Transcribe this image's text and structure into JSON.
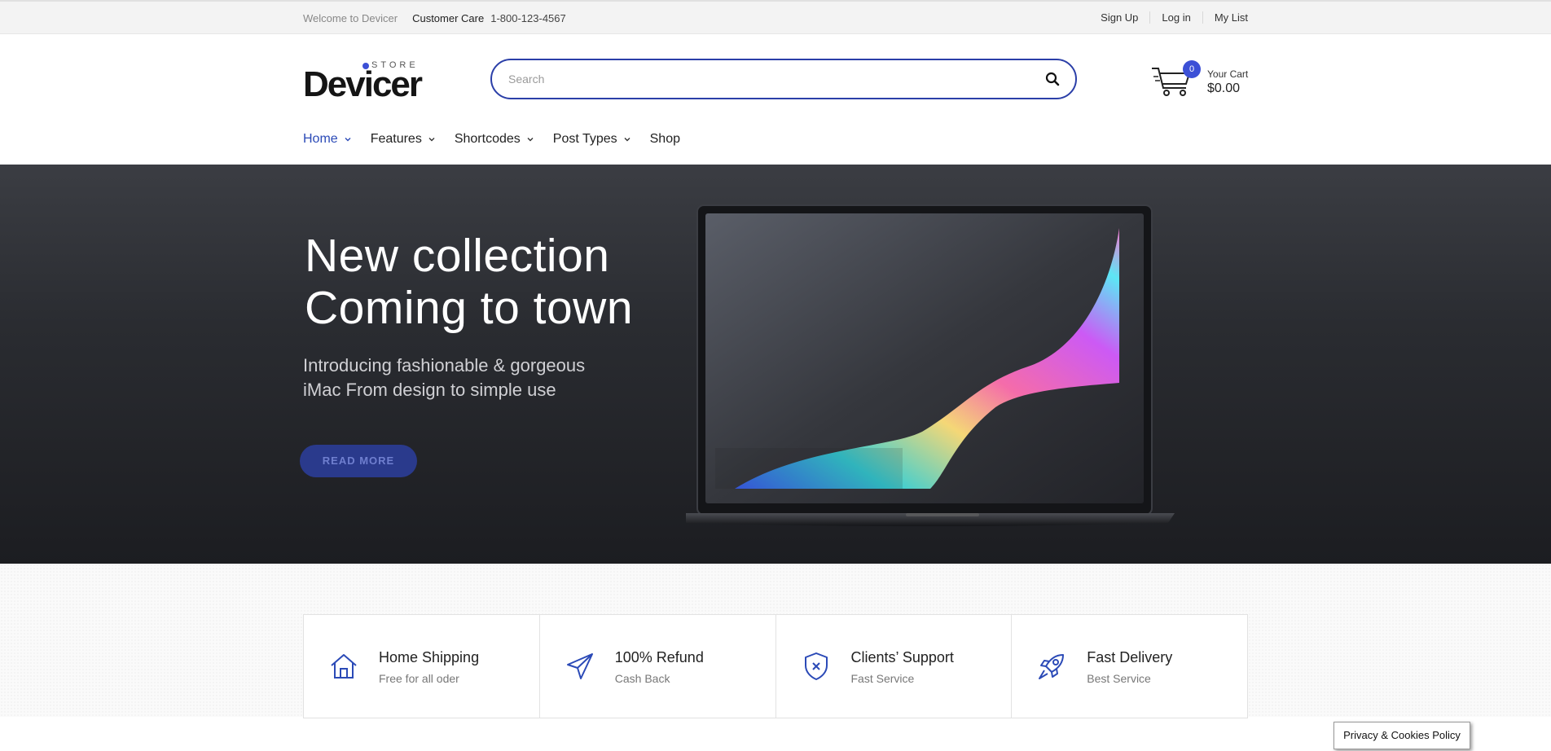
{
  "topbar": {
    "welcome": "Welcome to Devicer",
    "care_label": "Customer Care",
    "phone": "1-800-123-4567",
    "links": [
      "Sign Up",
      "Log in",
      "My List"
    ]
  },
  "header": {
    "logo_store": "STORE",
    "logo_name": "Devicer",
    "search_placeholder": "Search",
    "cart_count": "0",
    "cart_label": "Your Cart",
    "cart_total": "$0.00"
  },
  "nav": {
    "items": [
      {
        "label": "Home",
        "has_dropdown": true,
        "active": true
      },
      {
        "label": "Features",
        "has_dropdown": true
      },
      {
        "label": "Shortcodes",
        "has_dropdown": true
      },
      {
        "label": "Post Types",
        "has_dropdown": true
      },
      {
        "label": "Shop",
        "has_dropdown": false
      }
    ]
  },
  "hero": {
    "title_line1": "New collection",
    "title_line2": "Coming to town",
    "subtitle_line1": "Introducing fashionable & gorgeous",
    "subtitle_line2": "iMac From design to simple use",
    "button_label": "READ MORE"
  },
  "features": [
    {
      "title": "Home Shipping",
      "subtitle": "Free for all oder",
      "icon": "house-icon"
    },
    {
      "title": "100% Refund",
      "subtitle": "Cash Back",
      "icon": "paper-plane-icon"
    },
    {
      "title": "Clients’ Support",
      "subtitle": "Fast Service",
      "icon": "shield-icon"
    },
    {
      "title": "Fast Delivery",
      "subtitle": "Best Service",
      "icon": "rocket-icon"
    }
  ],
  "cookie": {
    "label": "Privacy & Cookies Policy"
  },
  "colors": {
    "accent": "#3c50d6",
    "search_border": "#2b3fa8",
    "nav_active": "#2b4ab7",
    "hero_button": "#2a3a8c"
  }
}
